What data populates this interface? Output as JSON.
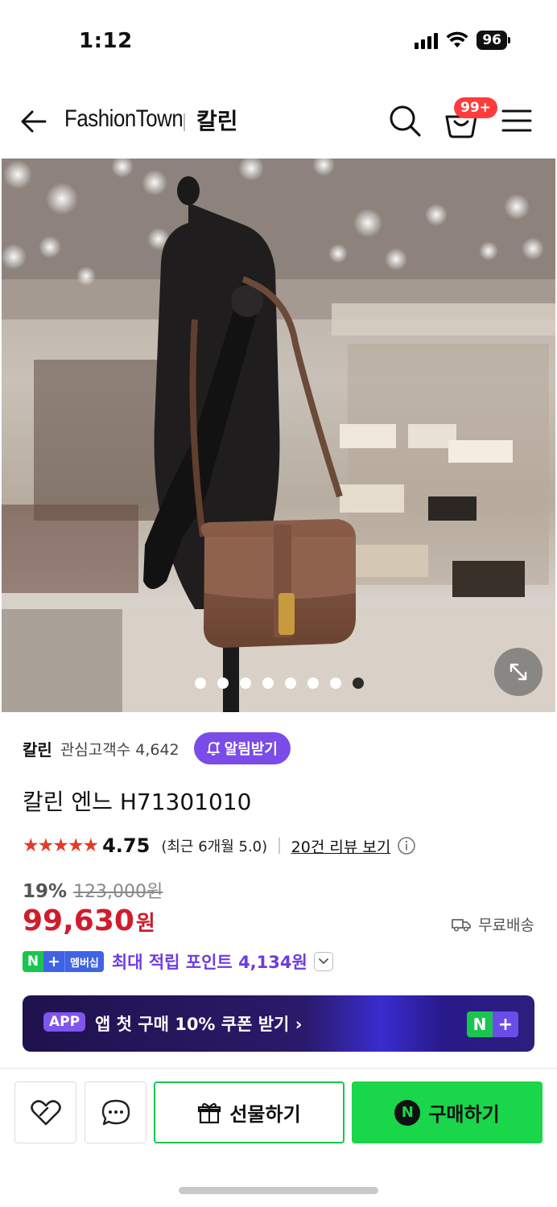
{
  "status": {
    "time": "1:12",
    "battery": "96"
  },
  "header": {
    "brand": "FashionTown",
    "store": "칼린",
    "cart_badge": "99+"
  },
  "gallery": {
    "total_images": 8,
    "active_index": 7
  },
  "product": {
    "brand_name": "칼린",
    "followers_label": "관심고객수 4,642",
    "alarm_label": "알림받기",
    "title": "칼린 엔느 H71301010",
    "stars": "★★★★★",
    "rating": "4.75",
    "recent_rating": "(최근 6개월 5.0)",
    "review_link": "20건 리뷰 보기",
    "discount_rate": "19%",
    "original_price": "123,000원",
    "price": "99,630",
    "price_unit": "원",
    "shipping": "무료배송",
    "membership_n": "N",
    "membership_plus": "+",
    "membership_label": "멤버십",
    "point_text": "최대 적립 포인트 4,134원"
  },
  "banner": {
    "tag": "APP",
    "text": "앱 첫 구매 10% 쿠폰 받기 ›",
    "n": "N",
    "plus": "+"
  },
  "actions": {
    "gift_label": "선물하기",
    "buy_n": "N",
    "buy_label": "구매하기"
  },
  "colors": {
    "accent_purple": "#7b4ce8",
    "price_red": "#d01c2b",
    "naver_green": "#19d64a",
    "star_red": "#e23a2a"
  }
}
